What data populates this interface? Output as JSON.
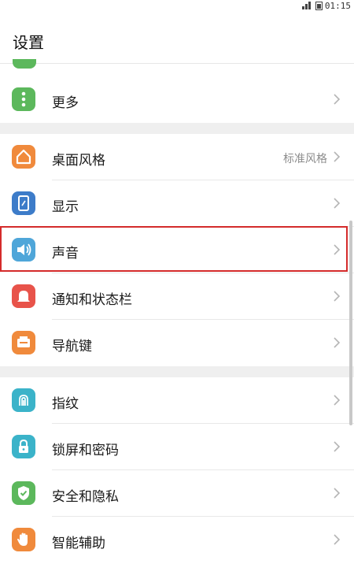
{
  "status_bar": {
    "time": "01:15"
  },
  "header": {
    "title": "设置"
  },
  "settings": {
    "more": {
      "label": "更多",
      "icon": "more-dots-icon",
      "color": "#5cb85c"
    },
    "home_style": {
      "label": "桌面风格",
      "value": "标准风格",
      "icon": "home-icon",
      "color": "#f08a3c"
    },
    "display": {
      "label": "显示",
      "icon": "display-icon",
      "color": "#3d7cc9"
    },
    "sound": {
      "label": "声音",
      "icon": "speaker-icon",
      "color": "#4fa6d9"
    },
    "notifications": {
      "label": "通知和状态栏",
      "icon": "bell-icon",
      "color": "#e8534a"
    },
    "navigation": {
      "label": "导航键",
      "icon": "navigation-icon",
      "color": "#f08a3c"
    },
    "fingerprint": {
      "label": "指纹",
      "icon": "fingerprint-icon",
      "color": "#3bb3c9"
    },
    "lock_screen": {
      "label": "锁屏和密码",
      "icon": "lock-icon",
      "color": "#3bb3c9"
    },
    "security": {
      "label": "安全和隐私",
      "icon": "shield-icon",
      "color": "#5cb85c"
    },
    "assist": {
      "label": "智能辅助",
      "icon": "hand-icon",
      "color": "#f08a3c"
    }
  },
  "highlight_color": "#d42b2b"
}
